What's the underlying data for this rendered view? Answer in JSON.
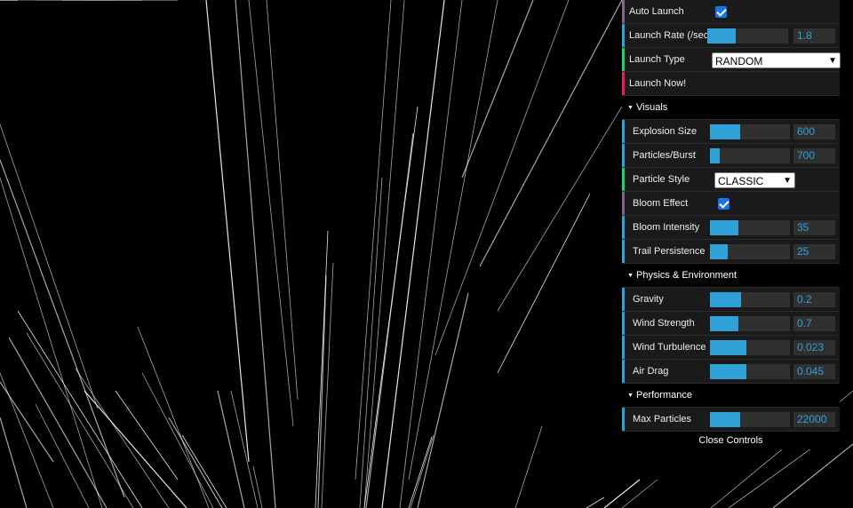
{
  "gui": {
    "top_controls": {
      "auto_launch": {
        "label": "Auto Launch",
        "checked": true
      },
      "launch_rate": {
        "label": "Launch Rate (/sec)",
        "value": "1.8",
        "fraction": 0.35
      },
      "launch_type": {
        "label": "Launch Type",
        "value": "RANDOM"
      },
      "launch_now": {
        "label": "Launch Now!"
      }
    },
    "visuals": {
      "title": "Visuals",
      "explosion_size": {
        "label": "Explosion Size",
        "value": "600",
        "fraction": 0.38
      },
      "particles_burst": {
        "label": "Particles/Burst",
        "value": "700",
        "fraction": 0.12
      },
      "particle_style": {
        "label": "Particle Style",
        "value": "CLASSIC"
      },
      "bloom_effect": {
        "label": "Bloom Effect",
        "checked": true
      },
      "bloom_intensity": {
        "label": "Bloom Intensity",
        "value": "35",
        "fraction": 0.35
      },
      "trail_persistence": {
        "label": "Trail Persistence",
        "value": "25",
        "fraction": 0.22
      }
    },
    "physics": {
      "title": "Physics & Environment",
      "gravity": {
        "label": "Gravity",
        "value": "0.2",
        "fraction": 0.39
      },
      "wind_strength": {
        "label": "Wind Strength",
        "value": "0.7",
        "fraction": 0.35
      },
      "wind_turbulence": {
        "label": "Wind Turbulence",
        "value": "0.023",
        "fraction": 0.45
      },
      "air_drag": {
        "label": "Air Drag",
        "value": "0.045",
        "fraction": 0.45
      }
    },
    "performance": {
      "title": "Performance",
      "max_particles": {
        "label": "Max Particles",
        "value": "22000",
        "fraction": 0.38
      }
    },
    "close_label": "Close Controls"
  },
  "colors": {
    "background": "#000000",
    "panel": "#1a1a1a",
    "number_accent": "#2fa1d6",
    "boolean_accent": "#806787",
    "string_accent": "#1ed36f",
    "function_accent": "#e61d5f",
    "streak": "#ffffff"
  }
}
